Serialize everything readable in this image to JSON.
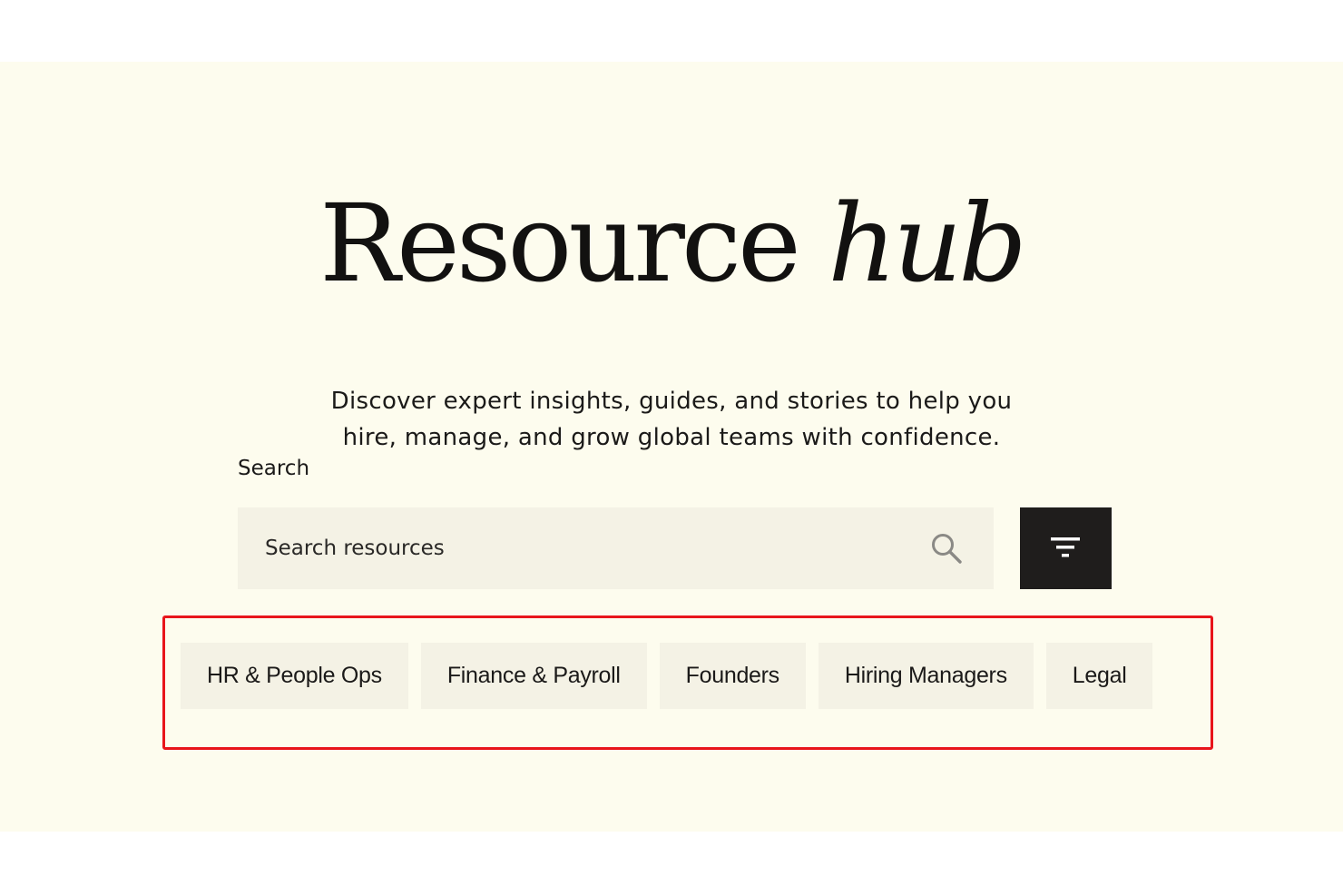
{
  "hero": {
    "title_main": "Resource",
    "title_italic": "hub",
    "subtitle_line1": "Discover expert insights, guides, and stories to help you",
    "subtitle_line2": "hire, manage, and grow global teams with confidence."
  },
  "search": {
    "label": "Search",
    "placeholder": "Search resources",
    "value": "",
    "search_icon": "magnifier-icon",
    "filter_icon": "filter-icon"
  },
  "categories": [
    {
      "label": "HR & People Ops"
    },
    {
      "label": "Finance & Payroll"
    },
    {
      "label": "Founders"
    },
    {
      "label": "Hiring Managers"
    },
    {
      "label": "Legal"
    }
  ],
  "colors": {
    "hero_background": "#fdfcee",
    "chip_background": "#f4f2e5",
    "filter_button": "#1f1d1c",
    "highlight_border": "#e8151b"
  }
}
